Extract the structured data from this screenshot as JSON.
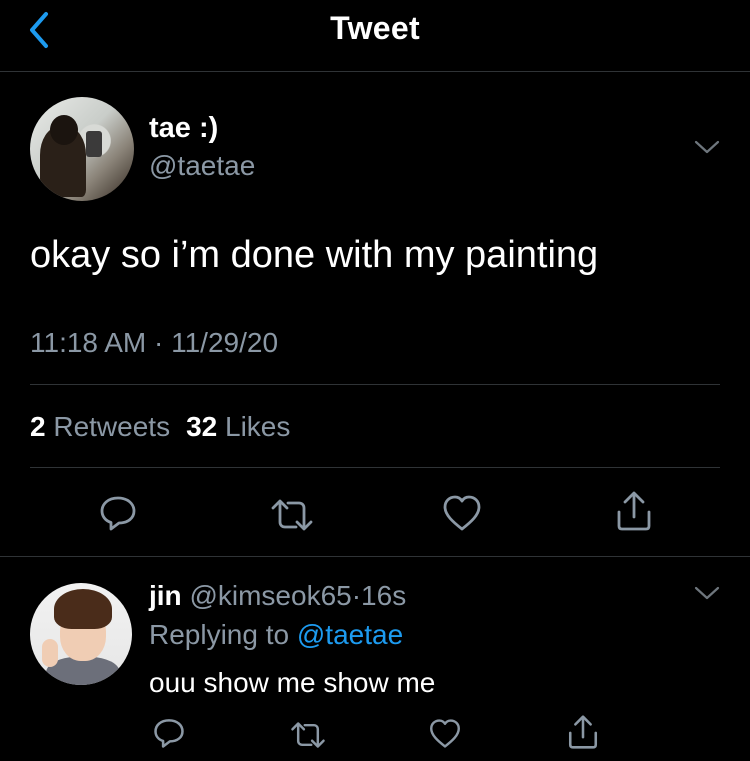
{
  "header": {
    "title": "Tweet",
    "back_icon": "chevron-left-icon",
    "accent_color": "#1d9bf0"
  },
  "tweet": {
    "author_name": "tae :)",
    "author_handle": "@taetae",
    "text": "okay so i’m done with my painting",
    "timestamp": "11:18 AM · 11/29/20",
    "retweets_count": "2",
    "retweets_label": "Retweets",
    "likes_count": "32",
    "likes_label": "Likes",
    "actions": [
      "reply-icon",
      "retweet-icon",
      "like-icon",
      "share-icon"
    ]
  },
  "reply": {
    "author_name": "jin",
    "author_handle": "@kimseok65",
    "separator": "·",
    "time": "16s",
    "replying_prefix": "Replying to",
    "replying_to": "@taetae",
    "text": "ouu show me show me",
    "actions": [
      "reply-icon",
      "retweet-icon",
      "like-icon",
      "share-icon"
    ]
  }
}
